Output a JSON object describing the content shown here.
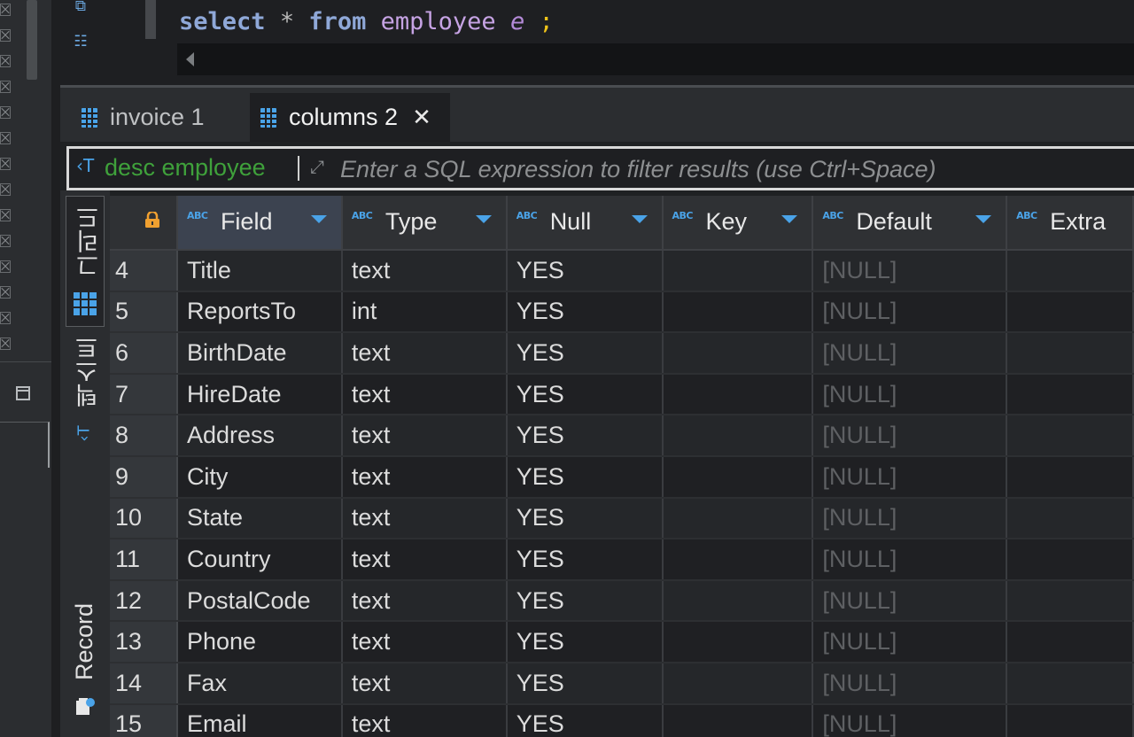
{
  "editor": {
    "sql": {
      "kw1": "select",
      "star": "*",
      "kw2": "from",
      "table": "employee",
      "alias": "e",
      "semi": ";"
    }
  },
  "tabs": [
    {
      "label": "invoice 1",
      "active": false
    },
    {
      "label": "columns 2",
      "active": true
    }
  ],
  "filter": {
    "history": "desc employee",
    "placeholder": "Enter a SQL expression to filter results (use Ctrl+Space)"
  },
  "side_tabs": {
    "grid": "그리드",
    "text": "텍스트",
    "record": "Record"
  },
  "grid": {
    "columns": [
      {
        "label": "Field",
        "type_badge": "ABC"
      },
      {
        "label": "Type",
        "type_badge": "ABC"
      },
      {
        "label": "Null",
        "type_badge": "ABC"
      },
      {
        "label": "Key",
        "type_badge": "ABC"
      },
      {
        "label": "Default",
        "type_badge": "ABC"
      },
      {
        "label": "Extra",
        "type_badge": "ABC"
      }
    ],
    "rows": [
      {
        "num": "4",
        "field": "Title",
        "type": "text",
        "null": "YES",
        "key": "",
        "default": "[NULL]",
        "extra": ""
      },
      {
        "num": "5",
        "field": "ReportsTo",
        "type": "int",
        "null": "YES",
        "key": "",
        "default": "[NULL]",
        "extra": ""
      },
      {
        "num": "6",
        "field": "BirthDate",
        "type": "text",
        "null": "YES",
        "key": "",
        "default": "[NULL]",
        "extra": ""
      },
      {
        "num": "7",
        "field": "HireDate",
        "type": "text",
        "null": "YES",
        "key": "",
        "default": "[NULL]",
        "extra": ""
      },
      {
        "num": "8",
        "field": "Address",
        "type": "text",
        "null": "YES",
        "key": "",
        "default": "[NULL]",
        "extra": ""
      },
      {
        "num": "9",
        "field": "City",
        "type": "text",
        "null": "YES",
        "key": "",
        "default": "[NULL]",
        "extra": ""
      },
      {
        "num": "10",
        "field": "State",
        "type": "text",
        "null": "YES",
        "key": "",
        "default": "[NULL]",
        "extra": ""
      },
      {
        "num": "11",
        "field": "Country",
        "type": "text",
        "null": "YES",
        "key": "",
        "default": "[NULL]",
        "extra": ""
      },
      {
        "num": "12",
        "field": "PostalCode",
        "type": "text",
        "null": "YES",
        "key": "",
        "default": "[NULL]",
        "extra": ""
      },
      {
        "num": "13",
        "field": "Phone",
        "type": "text",
        "null": "YES",
        "key": "",
        "default": "[NULL]",
        "extra": ""
      },
      {
        "num": "14",
        "field": "Fax",
        "type": "text",
        "null": "YES",
        "key": "",
        "default": "[NULL]",
        "extra": ""
      },
      {
        "num": "15",
        "field": "Email",
        "type": "text",
        "null": "YES",
        "key": "",
        "default": "[NULL]",
        "extra": ""
      }
    ]
  },
  "colors": {
    "accent": "#4aa3e8",
    "lock": "#f0a030",
    "filter_history": "#3fa13b",
    "null_value": "#5e6063"
  },
  "icons": {
    "editor_top": "sql-format-icon",
    "editor_second": "outline-icon",
    "tab": "table-grid-icon",
    "lock": "lock-icon",
    "record": "record-icon"
  }
}
